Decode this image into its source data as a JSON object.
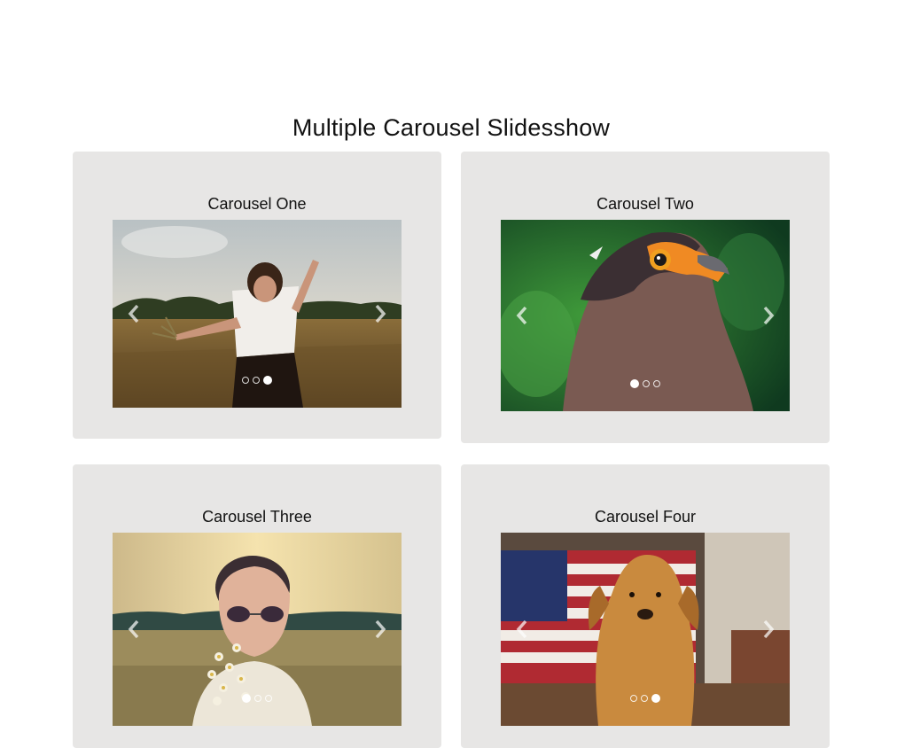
{
  "page": {
    "title": "Multiple Carousel Slidesshow"
  },
  "carousels": [
    {
      "title": "Carousel One",
      "photo": "woman-in-field-photo",
      "slide_count": 3,
      "active_slide": 3
    },
    {
      "title": "Carousel Two",
      "photo": "eagle-photo",
      "slide_count": 3,
      "active_slide": 1
    },
    {
      "title": "Carousel Three",
      "photo": "woman-with-sunglasses-photo",
      "slide_count": 3,
      "active_slide": 1
    },
    {
      "title": "Carousel Four",
      "photo": "golden-retriever-photo",
      "slide_count": 3,
      "active_slide": 3
    }
  ],
  "controls": {
    "prev_icon": "chevron-left-icon",
    "next_icon": "chevron-right-icon"
  },
  "colors": {
    "card_background": "#e7e6e5",
    "page_background": "#ffffff",
    "indicator": "#ffffff"
  }
}
